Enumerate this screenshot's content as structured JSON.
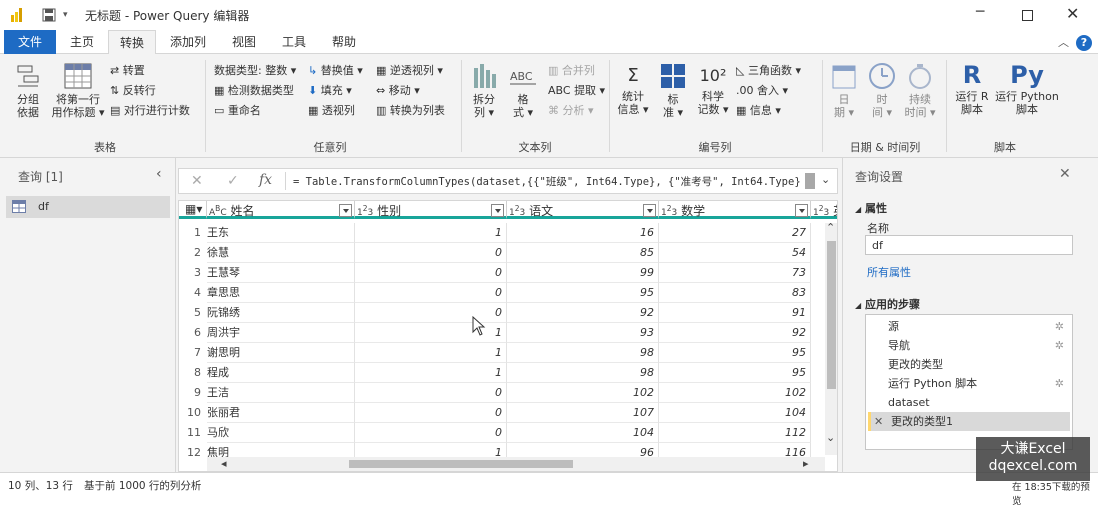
{
  "title": "无标题 - Power Query 编辑器",
  "tabs": [
    {
      "label": "文件"
    },
    {
      "label": "主页"
    },
    {
      "label": "转换"
    },
    {
      "label": "添加列"
    },
    {
      "label": "视图"
    },
    {
      "label": "工具"
    },
    {
      "label": "帮助"
    }
  ],
  "ribbon": {
    "table": {
      "group_by": [
        "分组",
        "依据"
      ],
      "first_row_header": [
        "将第一行",
        "用作标题"
      ],
      "transpose": "转置",
      "reverse_rows": "反转行",
      "count_rows": "对行进行计数",
      "label": "表格"
    },
    "any_column": {
      "data_type": "数据类型: 整数",
      "detect_type": "检测数据类型",
      "rename": "重命名",
      "replace_values": "替换值",
      "fill": "填充",
      "pivot_column": "透视列",
      "unpivot_column": "逆透视列",
      "move": "移动",
      "to_list": "转换为列表",
      "label": "任意列"
    },
    "text_column": {
      "split_column": [
        "拆分",
        "列"
      ],
      "format": [
        "格",
        "式"
      ],
      "merge_columns": "合并列",
      "extract": "提取",
      "parse": "分析",
      "label": "文本列"
    },
    "number_column": {
      "statistics": [
        "统计",
        "信息"
      ],
      "standard": [
        "标",
        "准"
      ],
      "scientific": [
        "科学",
        "记数"
      ],
      "trigonometry": "三角函数",
      "rounding": "舍入",
      "information": "信息",
      "label": "编号列"
    },
    "date_time_column": {
      "date": [
        "日",
        "期"
      ],
      "time": [
        "时",
        "间"
      ],
      "duration": [
        "持续",
        "时间"
      ],
      "label": "日期 & 时间列"
    },
    "scripts": {
      "run_r": [
        "运行 R",
        "脚本"
      ],
      "run_python": [
        "运行 Python",
        "脚本"
      ],
      "label": "脚本"
    }
  },
  "queries": {
    "header": "查询 [1]",
    "items": [
      {
        "label": "df"
      }
    ]
  },
  "formula": "= Table.TransformColumnTypes(dataset,{{\"班级\", Int64.Type}, {\"准考号\", Int64.Type}",
  "columns": [
    {
      "type": "ABC",
      "name": "姓名"
    },
    {
      "type": "123",
      "name": "性别"
    },
    {
      "type": "123",
      "name": "语文"
    },
    {
      "type": "123",
      "name": "数学"
    },
    {
      "type": "123",
      "name": "英"
    }
  ],
  "rows": [
    {
      "n": "1",
      "name": "王东",
      "gender": "1",
      "chinese": "16",
      "math": "27"
    },
    {
      "n": "2",
      "name": "徐慧",
      "gender": "0",
      "chinese": "85",
      "math": "54"
    },
    {
      "n": "3",
      "name": "王慧琴",
      "gender": "0",
      "chinese": "99",
      "math": "73"
    },
    {
      "n": "4",
      "name": "章思思",
      "gender": "0",
      "chinese": "95",
      "math": "83"
    },
    {
      "n": "5",
      "name": "阮锦绣",
      "gender": "0",
      "chinese": "92",
      "math": "91"
    },
    {
      "n": "6",
      "name": "周洪宇",
      "gender": "1",
      "chinese": "93",
      "math": "92"
    },
    {
      "n": "7",
      "name": "谢思明",
      "gender": "1",
      "chinese": "98",
      "math": "95"
    },
    {
      "n": "8",
      "name": "程成",
      "gender": "1",
      "chinese": "98",
      "math": "95"
    },
    {
      "n": "9",
      "name": "王洁",
      "gender": "0",
      "chinese": "102",
      "math": "102"
    },
    {
      "n": "10",
      "name": "张丽君",
      "gender": "0",
      "chinese": "107",
      "math": "104"
    },
    {
      "n": "11",
      "name": "马欣",
      "gender": "0",
      "chinese": "104",
      "math": "112"
    },
    {
      "n": "12",
      "name": "焦明",
      "gender": "1",
      "chinese": "96",
      "math": "116"
    }
  ],
  "settings": {
    "header": "查询设置",
    "properties_label": "属性",
    "name_label": "名称",
    "name_value": "df",
    "all_properties": "所有属性",
    "applied_steps_label": "应用的步骤",
    "steps": [
      {
        "label": "源",
        "gear": true
      },
      {
        "label": "导航",
        "gear": true
      },
      {
        "label": "更改的类型",
        "gear": false
      },
      {
        "label": "运行 Python 脚本",
        "gear": true
      },
      {
        "label": "dataset",
        "gear": false
      },
      {
        "label": "更改的类型1",
        "gear": false,
        "selected": true
      }
    ]
  },
  "status": {
    "left": "10 列、13 行",
    "middle": "基于前 1000 行的列分析",
    "right": "在 18:35下载的预览"
  },
  "watermark": {
    "line1": "大谦Excel",
    "line2": "dqexcel.com"
  },
  "colors": {
    "accent": "#1e6bc4",
    "table_header_bar": "#18a59a",
    "selected_step": "#ffd76e"
  }
}
